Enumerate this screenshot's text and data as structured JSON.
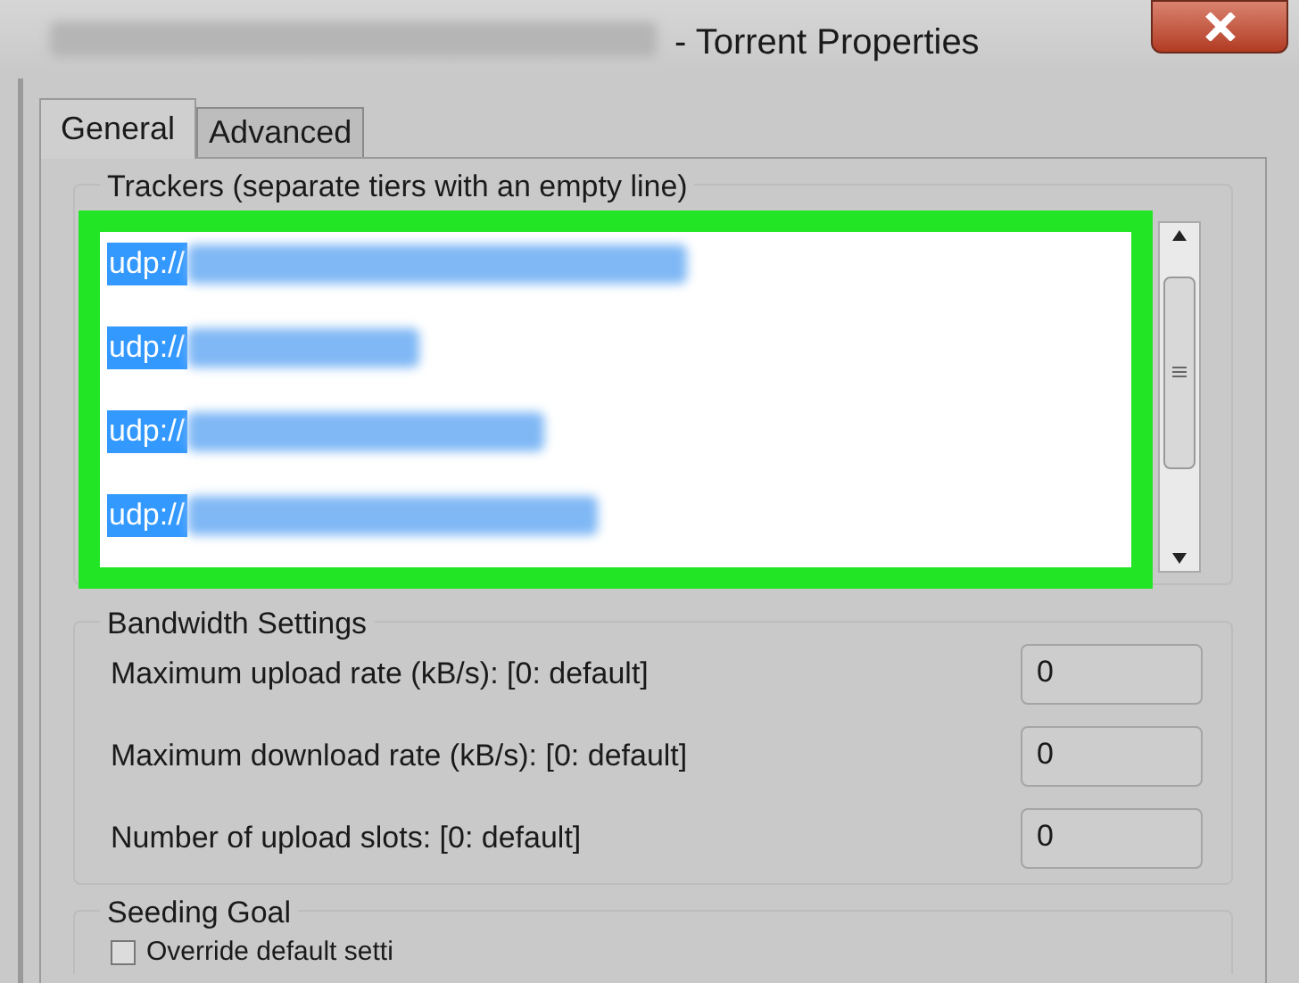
{
  "window": {
    "title": "- Torrent Properties"
  },
  "tabs": [
    {
      "label": "General",
      "selected": true
    },
    {
      "label": "Advanced",
      "selected": false
    }
  ],
  "trackers": {
    "legend": "Trackers (separate tiers with an empty line)",
    "lines": [
      "udp://",
      "udp://",
      "udp://",
      "udp://"
    ]
  },
  "bandwidth": {
    "legend": "Bandwidth Settings",
    "fields": [
      {
        "label": "Maximum upload rate (kB/s): [0: default]",
        "value": "0"
      },
      {
        "label": "Maximum download rate (kB/s): [0: default]",
        "value": "0"
      },
      {
        "label": "Number of upload slots: [0: default]",
        "value": "0"
      }
    ]
  },
  "seeding": {
    "legend": "Seeding Goal",
    "override": {
      "label": "Override default setti",
      "checked": false
    }
  }
}
